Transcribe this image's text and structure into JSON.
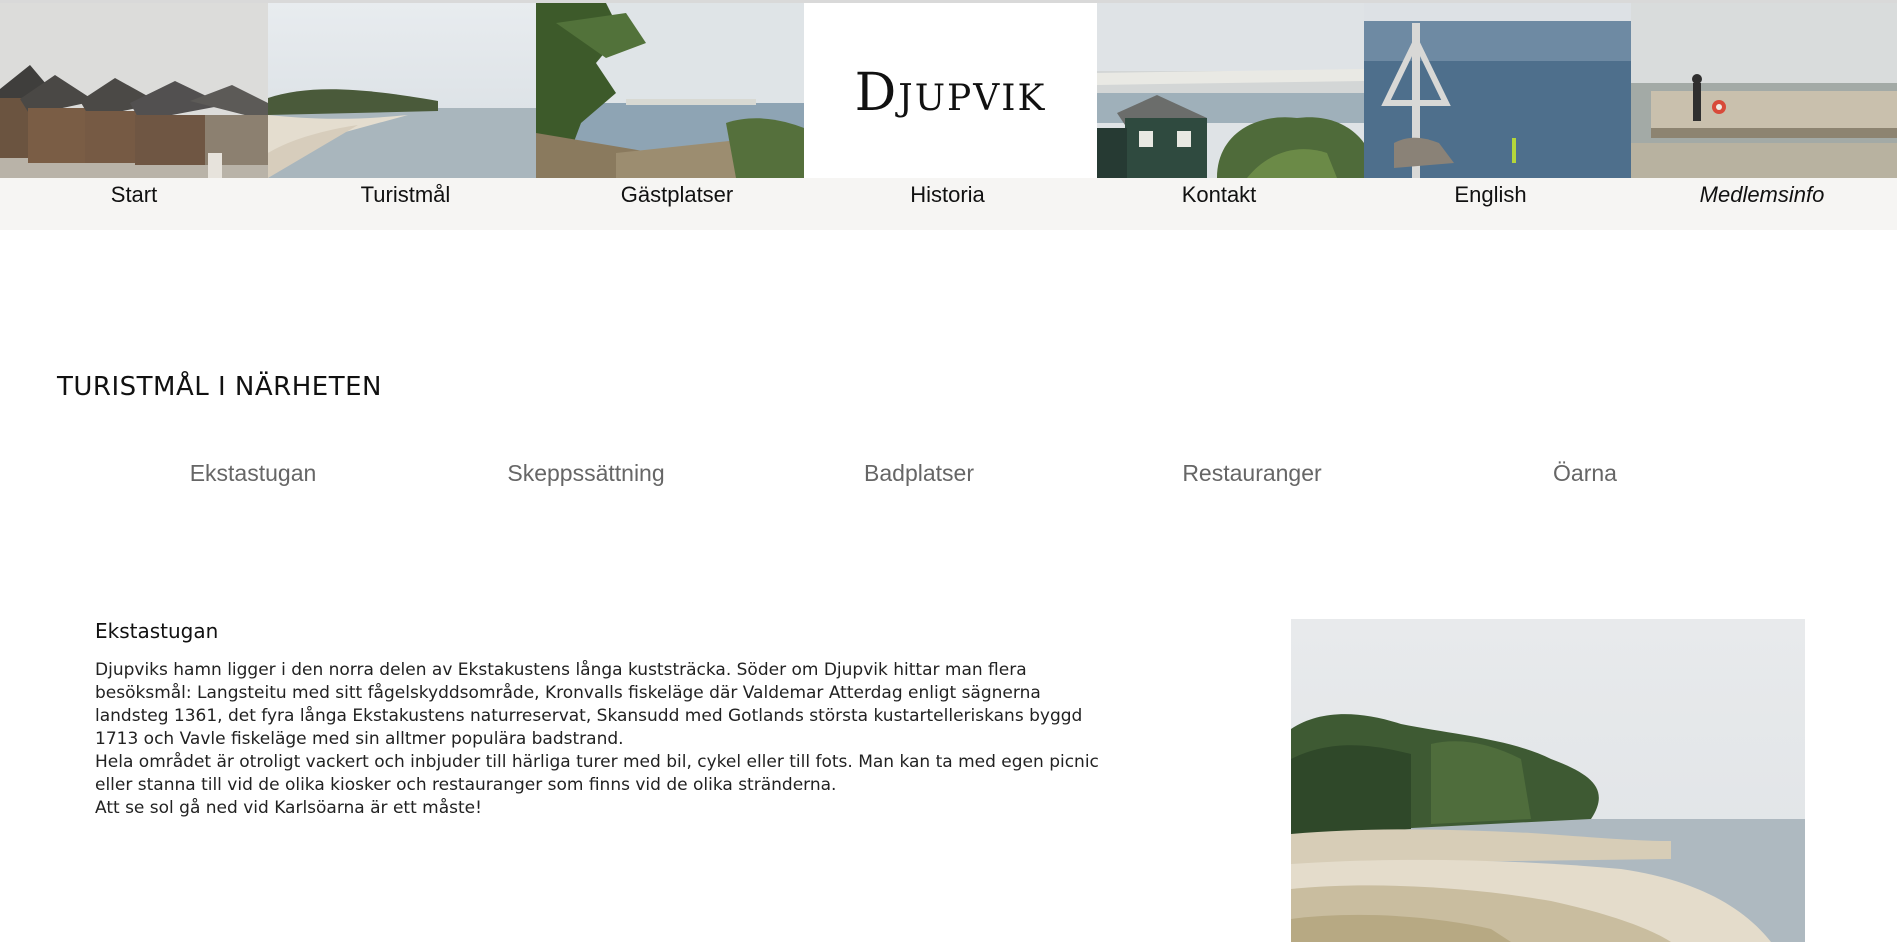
{
  "header": {
    "logo_text": "Djupvik",
    "images": [
      "beach-cabins-photo",
      "coastline-photo",
      "pine-tree-coast-photo",
      "cottage-coast-photo",
      "sea-marker-photo",
      "pier-photo"
    ]
  },
  "nav": {
    "items": [
      {
        "label": "Start"
      },
      {
        "label": "Turistmål"
      },
      {
        "label": "Gästplatser"
      },
      {
        "label": "Historia"
      },
      {
        "label": "Kontakt"
      },
      {
        "label": "English"
      },
      {
        "label": "Medlemsinfo"
      }
    ]
  },
  "main": {
    "title": "TURISTMÅL I NÄRHETEN",
    "subnav": [
      {
        "label": "Ekstastugan"
      },
      {
        "label": "Skeppssättning"
      },
      {
        "label": "Badplatser"
      },
      {
        "label": "Restauranger"
      },
      {
        "label": "Öarna"
      }
    ],
    "article": {
      "heading": "Ekstastugan",
      "paragraphs": [
        "Djupviks hamn ligger i den norra delen av Ekstakustens långa kuststräcka. Söder om Djupvik hittar man flera besöksmål: Langsteitu med sitt fågelskyddsområde, Kronvalls fiskeläge där Valdemar Atterdag enligt sägnerna landsteg 1361, det fyra långa Ekstakustens naturreservat, Skansudd med Gotlands största kustartelleriskans byggd 1713 och Vavle fiskeläge med sin alltmer populära badstrand.",
        "Hela området är otroligt vackert och inbjuder till härliga turer med bil, cykel eller till fots. Man kan ta med egen picnic eller stanna till vid de olika kiosker och restauranger som finns vid de olika stränderna.",
        "Att se sol gå ned vid Karlsöarna är ett måste!"
      ]
    }
  },
  "colors": {
    "nav_background": "#f6f5f3",
    "subnav_text": "#666666",
    "text": "#111111"
  }
}
